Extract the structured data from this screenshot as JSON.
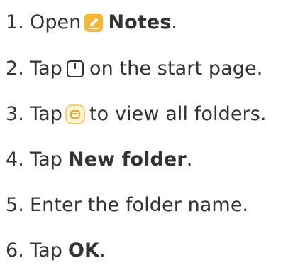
{
  "steps": [
    {
      "number": "1.",
      "before": "Open",
      "icon": "notes-app-icon",
      "bold": "Notes",
      "after": "."
    },
    {
      "number": "2.",
      "before": "Tap",
      "icon": "new-note-icon",
      "after": "on the start page."
    },
    {
      "number": "3.",
      "before": "Tap",
      "icon": "folders-icon",
      "after": "to view all folders."
    },
    {
      "number": "4.",
      "before": "Tap",
      "bold": "New folder",
      "after": "."
    },
    {
      "number": "5.",
      "text": "Enter the folder name."
    },
    {
      "number": "6.",
      "before": "Tap",
      "bold": "OK",
      "after": "."
    }
  ],
  "colors": {
    "text": "#333333",
    "notes_icon_yellow": "#F7B731",
    "folder_icon_yellow": "#F5C542"
  }
}
